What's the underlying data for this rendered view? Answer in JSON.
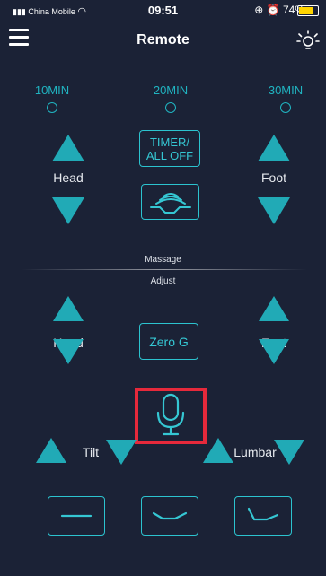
{
  "status_bar": {
    "carrier": "China Mobile",
    "time": "09:51",
    "battery": "74%",
    "battery_level": 0.74
  },
  "header": {
    "title": "Remote",
    "menu_icon": "hamburger-menu-icon",
    "light_icon": "sun-light-icon"
  },
  "timers": [
    {
      "label": "10MIN"
    },
    {
      "label": "20MIN"
    },
    {
      "label": "30MIN"
    }
  ],
  "massage": {
    "head_label": "Head",
    "foot_label": "Foot",
    "timer_button": "TIMER/\nALL OFF",
    "wave_icon": "massage-wave-icon"
  },
  "sections": {
    "massage": "Massage",
    "adjust": "Adjust"
  },
  "adjust": {
    "head_label": "Head",
    "foot_label": "Foot",
    "zero_g_button": "Zero G",
    "tilt_label": "Tilt",
    "lumbar_label": "Lumbar",
    "mic_icon": "microphone-icon"
  },
  "presets": [
    {
      "icon": "flat-preset-icon"
    },
    {
      "icon": "zero-gravity-preset-icon"
    },
    {
      "icon": "lounge-preset-icon"
    }
  ],
  "colors": {
    "background": "#1b2236",
    "accent": "#21aab6",
    "highlight": "#e6293b"
  }
}
